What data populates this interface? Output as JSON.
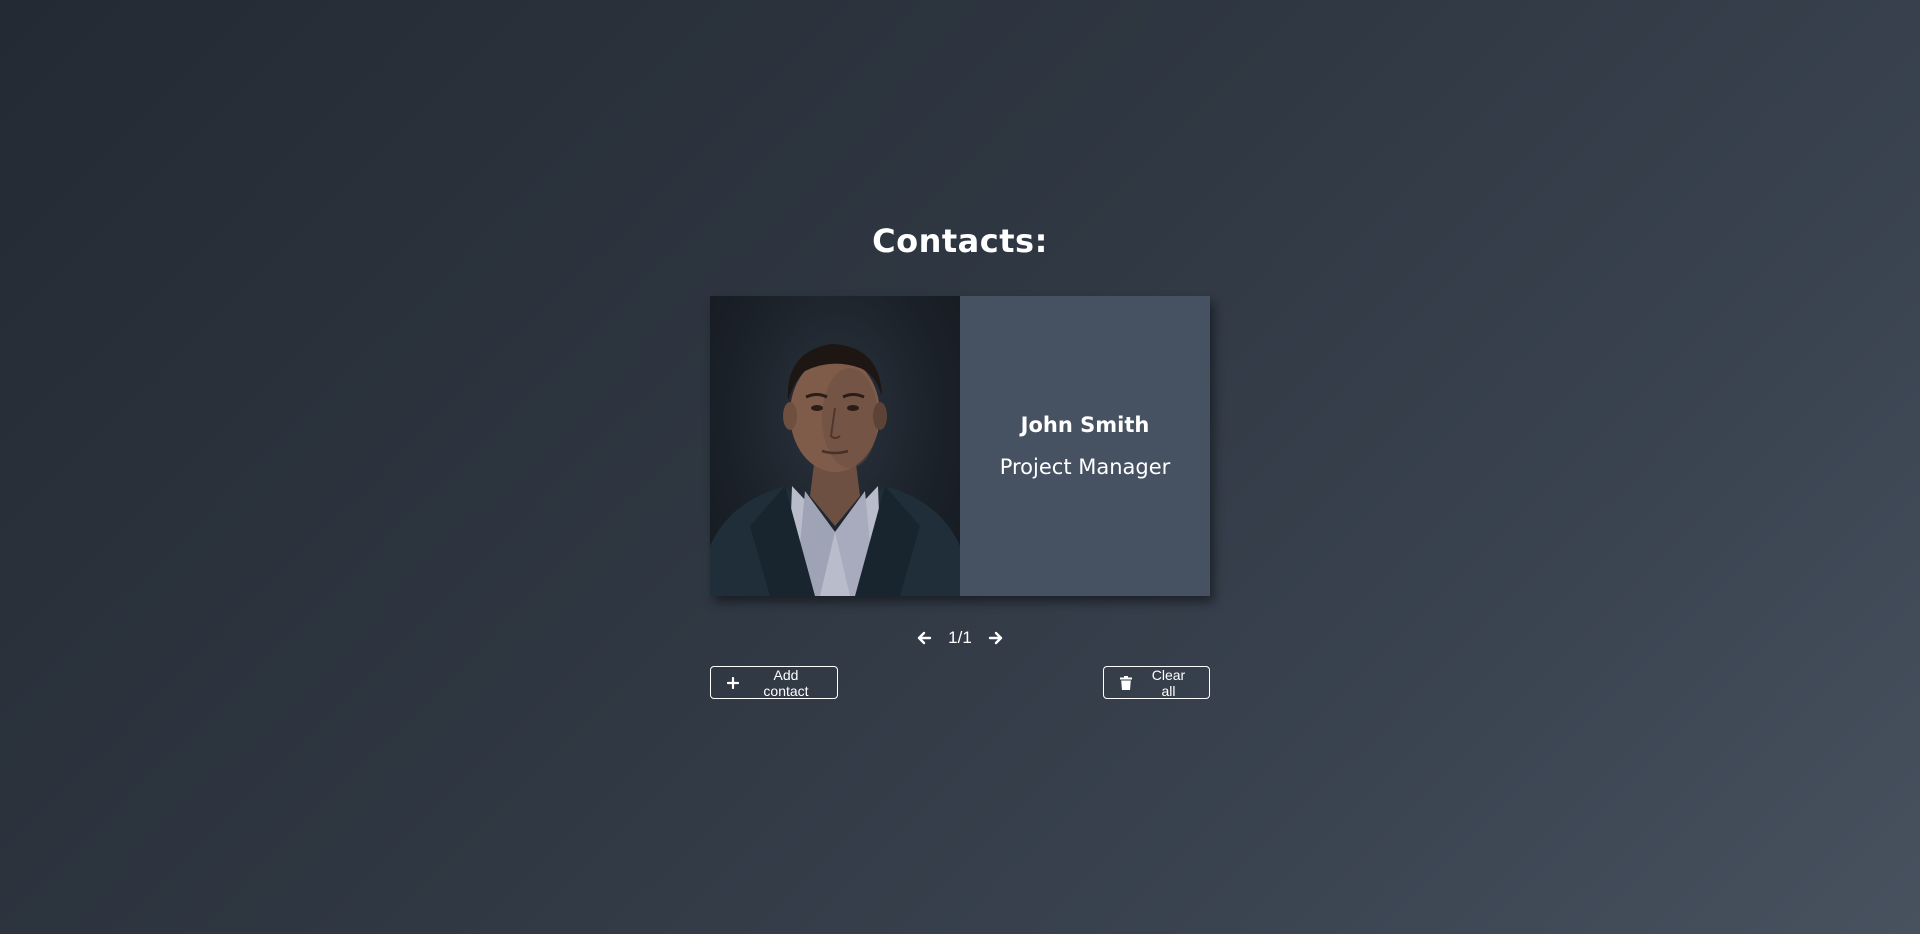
{
  "page": {
    "title": "Contacts:"
  },
  "contact": {
    "name": "John Smith",
    "role": "Project Manager",
    "photo_icon": "person-portrait"
  },
  "pager": {
    "prev_icon": "arrow-left-icon",
    "next_icon": "arrow-right-icon",
    "position": "1/1"
  },
  "actions": {
    "add_label": "Add contact",
    "add_icon": "plus-icon",
    "clear_label": "Clear all",
    "clear_icon": "trash-icon"
  },
  "colors": {
    "background_dark": "#242a33",
    "background_light": "#48525f",
    "card_info": "#465262",
    "text": "#ffffff"
  }
}
